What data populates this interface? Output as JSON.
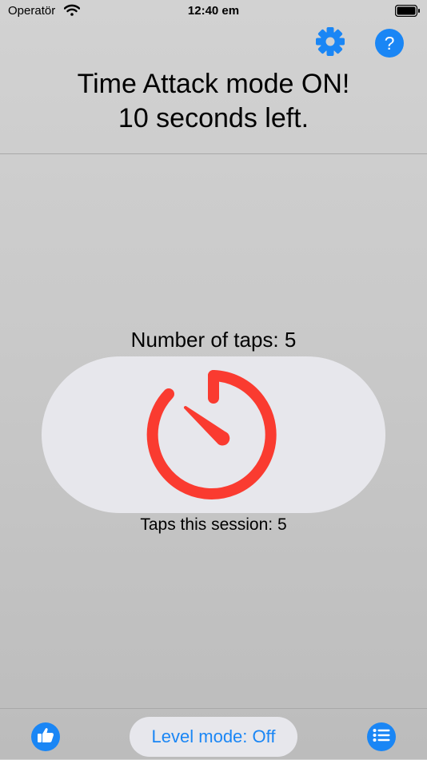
{
  "status_bar": {
    "carrier": "Operatör",
    "time": "12:40 em"
  },
  "header": {
    "settings_icon": "gear-icon",
    "help_label": "?",
    "mode_line1": "Time Attack mode ON!",
    "mode_line2": "10 seconds left."
  },
  "main": {
    "taps_label": "Number of taps: 5",
    "timer_icon": "stopwatch-icon",
    "session_label": "Taps this session: 5"
  },
  "bottom_bar": {
    "like_icon": "thumbs-up-icon",
    "level_mode_label": "Level mode: Off",
    "list_icon": "list-icon"
  },
  "colors": {
    "accent": "#1a86f5",
    "timer": "#fa3b30",
    "pad": "#e7e7ec"
  }
}
